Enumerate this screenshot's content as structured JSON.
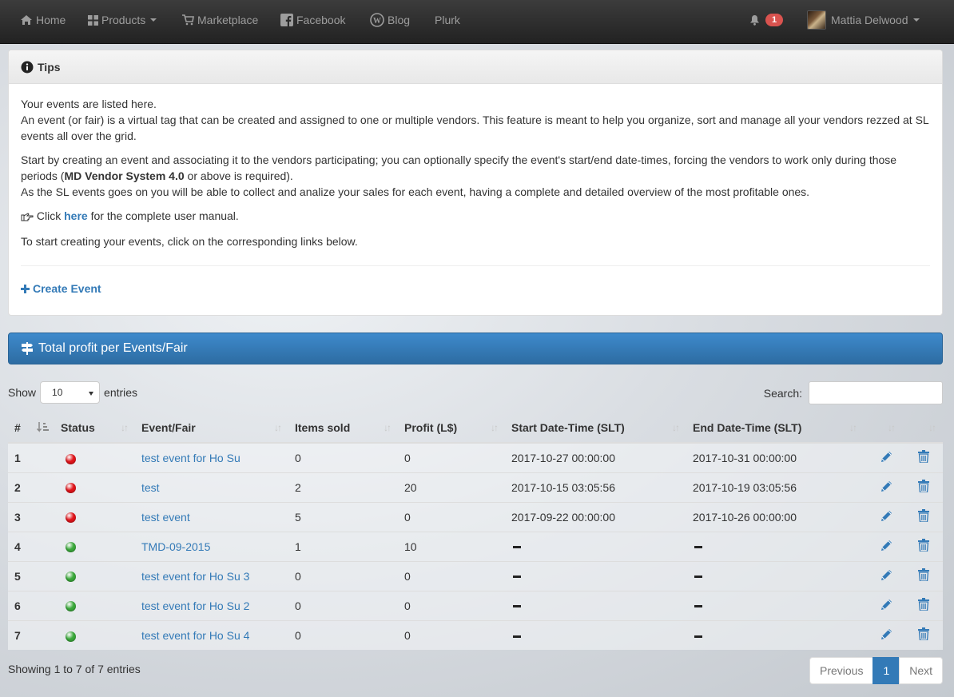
{
  "nav": {
    "home": "Home",
    "products": "Products",
    "marketplace": "Marketplace",
    "facebook": "Facebook",
    "blog": "Blog",
    "plurk": "Plurk",
    "notification_count": "1",
    "user": "Mattia Delwood"
  },
  "tips": {
    "title": "Tips",
    "line1": "Your events are listed here.",
    "line2": "An event (or fair) is a virtual tag that can be created and assigned to one or multiple vendors. This feature is meant to help you organize, sort and manage all your vendors rezzed at SL events all over the grid.",
    "line3_pre": "Start by creating an event and associating it to the vendors participating; you can optionally specify the event's start/end date-times, forcing the vendors to work only during those periods (",
    "line3_bold": "MD Vendor System 4.0",
    "line3_post": " or above is required).",
    "line4": "As the SL events goes on you will be able to collect and analize your sales for each event, having a complete and detailed overview of the most profitable ones.",
    "click_pre": "Click ",
    "click_link": "here",
    "click_post": " for the complete user manual.",
    "line5": "To start creating your events, click on the corresponding links below.",
    "create": "Create Event"
  },
  "profit_title": "Total profit per Events/Fair",
  "table_controls": {
    "show": "Show",
    "page_size": "10",
    "entries": "entries",
    "search": "Search:"
  },
  "columns": [
    "#",
    "",
    "Status",
    "Event/Fair",
    "Items sold",
    "Profit (L$)",
    "Start Date-Time (SLT)",
    "End Date-Time (SLT)",
    "",
    ""
  ],
  "rows": [
    {
      "n": "1",
      "status": "red",
      "name": "test event for Ho Su",
      "items": "0",
      "profit": "0",
      "start": "2017-10-27 00:00:00",
      "end": "2017-10-31 00:00:00"
    },
    {
      "n": "2",
      "status": "red",
      "name": "test",
      "items": "2",
      "profit": "20",
      "start": "2017-10-15 03:05:56",
      "end": "2017-10-19 03:05:56"
    },
    {
      "n": "3",
      "status": "red",
      "name": "test event",
      "items": "5",
      "profit": "0",
      "start": "2017-09-22 00:00:00",
      "end": "2017-10-26 00:00:00"
    },
    {
      "n": "4",
      "status": "green",
      "name": "TMD-09-2015",
      "items": "1",
      "profit": "10",
      "start": "",
      "end": ""
    },
    {
      "n": "5",
      "status": "green",
      "name": "test event for Ho Su 3",
      "items": "0",
      "profit": "0",
      "start": "",
      "end": ""
    },
    {
      "n": "6",
      "status": "green",
      "name": "test event for Ho Su 2",
      "items": "0",
      "profit": "0",
      "start": "",
      "end": ""
    },
    {
      "n": "7",
      "status": "green",
      "name": "test event for Ho Su 4",
      "items": "0",
      "profit": "0",
      "start": "",
      "end": ""
    }
  ],
  "footer": {
    "info": "Showing 1 to 7 of 7 entries",
    "prev": "Previous",
    "page": "1",
    "next": "Next"
  },
  "colors": {
    "red": "#e0141a",
    "green": "#3aa83a",
    "link": "#337ab7",
    "icon": "#337ab7"
  }
}
